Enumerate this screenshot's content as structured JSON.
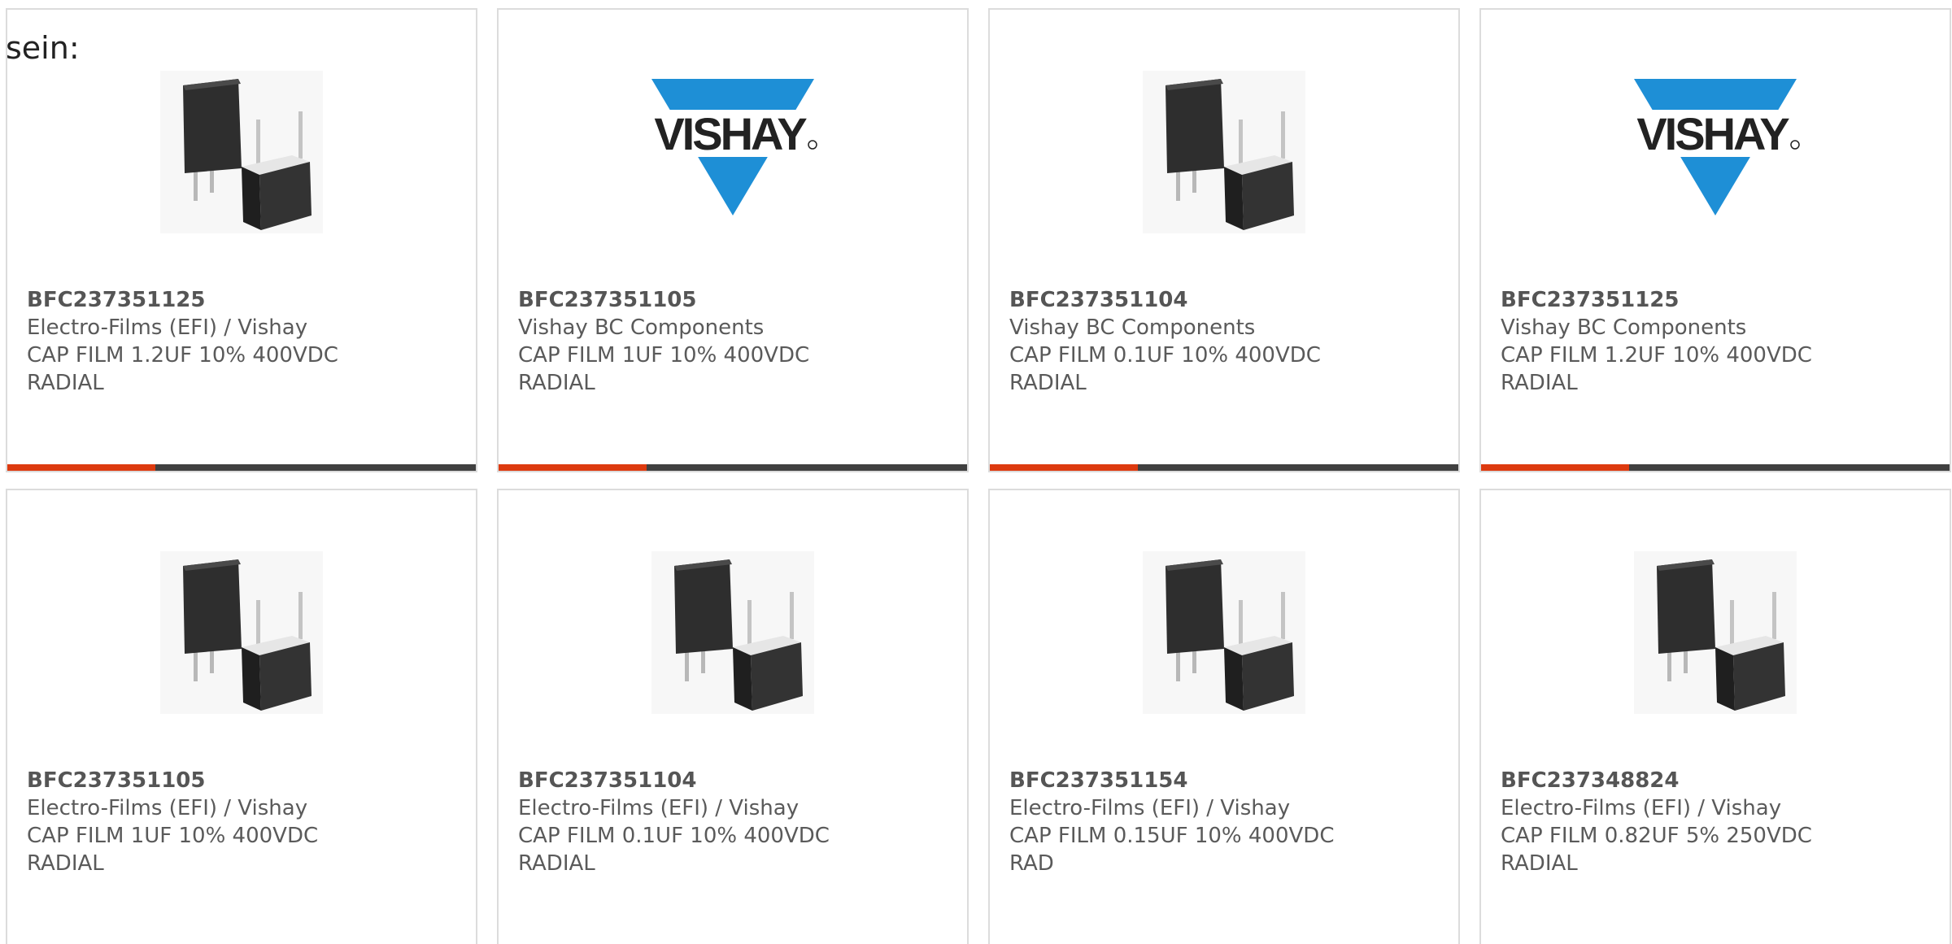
{
  "intro_text": "sein:",
  "colors": {
    "accent": "#dd3a0f",
    "bar_dark": "#404040",
    "vishay_blue": "#1e8fd6"
  },
  "products": [
    {
      "part": "BFC237351125",
      "manufacturer": "Electro-Films (EFI) / Vishay",
      "description": "CAP FILM 1.2UF 10% 400VDC",
      "package": "RADIAL",
      "image": "capacitor-photo",
      "show_bar": true
    },
    {
      "part": "BFC237351105",
      "manufacturer": "Vishay BC Components",
      "description": "CAP FILM 1UF 10% 400VDC",
      "package": "RADIAL",
      "image": "vishay-logo",
      "logo_text": "VISHAY",
      "show_bar": true
    },
    {
      "part": "BFC237351104",
      "manufacturer": "Vishay BC Components",
      "description": "CAP FILM 0.1UF 10% 400VDC",
      "package": "RADIAL",
      "image": "capacitor-photo",
      "show_bar": true
    },
    {
      "part": "BFC237351125",
      "manufacturer": "Vishay BC Components",
      "description": "CAP FILM 1.2UF 10% 400VDC",
      "package": "RADIAL",
      "image": "vishay-logo",
      "logo_text": "VISHAY",
      "show_bar": true
    },
    {
      "part": "BFC237351105",
      "manufacturer": "Electro-Films (EFI) / Vishay",
      "description": "CAP FILM 1UF 10% 400VDC",
      "package": "RADIAL",
      "image": "capacitor-photo",
      "show_bar": false
    },
    {
      "part": "BFC237351104",
      "manufacturer": "Electro-Films (EFI) / Vishay",
      "description": "CAP FILM 0.1UF 10% 400VDC",
      "package": "RADIAL",
      "image": "capacitor-photo",
      "show_bar": false
    },
    {
      "part": "BFC237351154",
      "manufacturer": "Electro-Films (EFI) / Vishay",
      "description": "CAP FILM 0.15UF 10% 400VDC",
      "package": "RAD",
      "image": "capacitor-photo",
      "show_bar": false
    },
    {
      "part": "BFC237348824",
      "manufacturer": "Electro-Films (EFI) / Vishay",
      "description": "CAP FILM 0.82UF 5% 250VDC",
      "package": "RADIAL",
      "image": "capacitor-photo",
      "show_bar": false
    }
  ]
}
